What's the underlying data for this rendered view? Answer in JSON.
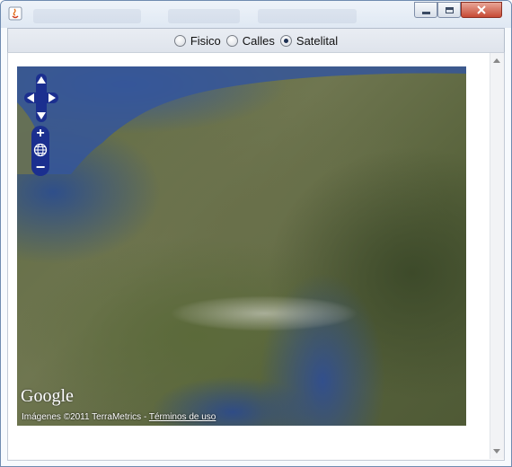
{
  "window": {
    "title": "",
    "buttons": [
      "minimize",
      "maximize",
      "close"
    ]
  },
  "map_types": {
    "options": [
      {
        "label": "Fisico",
        "selected": false
      },
      {
        "label": "Calles",
        "selected": false
      },
      {
        "label": "Satelital",
        "selected": true
      }
    ]
  },
  "map": {
    "logo": "Google",
    "credits_prefix": "Imágenes ©2011 TerraMetrics - ",
    "terms_link": "Términos de uso",
    "controls": {
      "pan": [
        "pan-up-icon",
        "pan-left-icon",
        "pan-right-icon",
        "pan-down-icon"
      ],
      "zoom": [
        "zoom-in-icon",
        "globe-icon",
        "zoom-out-icon"
      ]
    }
  },
  "colors": {
    "control_blue": "#1b2f8f",
    "selected_radio": "#1c2f52"
  }
}
